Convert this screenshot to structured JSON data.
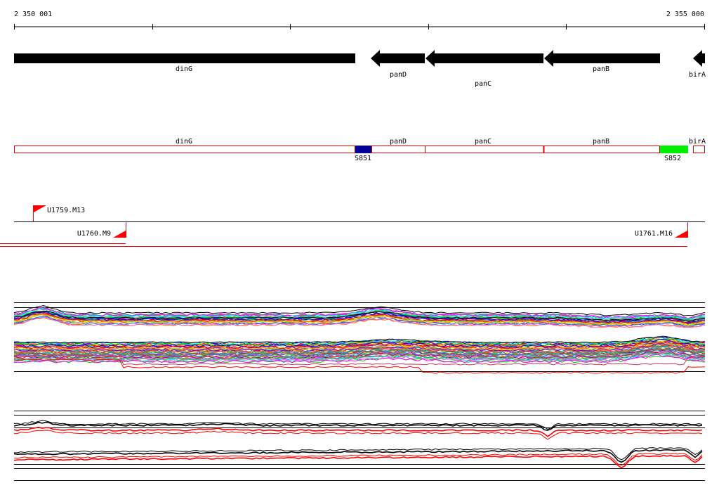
{
  "ruler": {
    "start_label": "2 350 001",
    "end_label": "2 355 000"
  },
  "genes": [
    {
      "name": "dinG",
      "strand": "forward"
    },
    {
      "name": "panD",
      "strand": "reverse"
    },
    {
      "name": "panC",
      "strand": "reverse"
    },
    {
      "name": "panB",
      "strand": "reverse"
    },
    {
      "name": "birA",
      "strand": "reverse"
    }
  ],
  "features": {
    "boxes": [
      {
        "name": "dinG"
      },
      {
        "name": "panD"
      },
      {
        "name": "panC"
      },
      {
        "name": "panB"
      },
      {
        "name": "birA"
      }
    ],
    "markers": [
      {
        "name": "S851",
        "color": "#000099"
      },
      {
        "name": "S852",
        "color": "#00ee00"
      }
    ]
  },
  "probes": [
    {
      "name": "U1759.M13"
    },
    {
      "name": "U1760.M9"
    },
    {
      "name": "U1761.M16"
    }
  ],
  "colors": {
    "gene_arrow": "#000000",
    "feature_outline": "#e00000",
    "probe_flag": "#ff0000",
    "trace_black": "#000000",
    "trace_red": "#ff0000"
  }
}
